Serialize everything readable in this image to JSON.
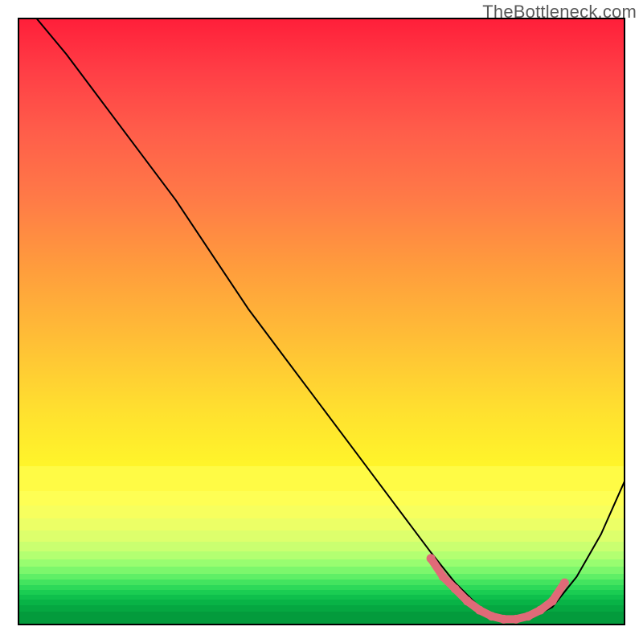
{
  "watermark": "TheBottleneck.com",
  "chart_data": {
    "type": "line",
    "title": "",
    "xlabel": "",
    "ylabel": "",
    "xlim": [
      0,
      100
    ],
    "ylim": [
      0,
      100
    ],
    "grid": false,
    "legend": false,
    "series": [
      {
        "name": "curve",
        "color": "#000000",
        "x": [
          3,
          8,
          14,
          20,
          26,
          32,
          38,
          44,
          50,
          56,
          62,
          68,
          72,
          76,
          80,
          84,
          88,
          92,
          96,
          100
        ],
        "y": [
          100,
          94,
          86,
          78,
          70,
          61,
          52,
          44,
          36,
          28,
          20,
          12,
          7,
          3,
          1,
          1,
          3,
          8,
          15,
          24
        ]
      }
    ],
    "highlight": {
      "name": "optimal-range",
      "color": "#e06a78",
      "x": [
        68,
        70,
        72,
        74,
        76,
        78,
        80,
        82,
        84,
        86,
        88,
        90
      ],
      "y": [
        11,
        8,
        6,
        4,
        2.5,
        1.5,
        1,
        1,
        1.5,
        2.5,
        4,
        7
      ]
    },
    "background_gradient_bands": [
      {
        "height_pct": 4.0,
        "color": "#fffb45"
      },
      {
        "height_pct": 2.4,
        "color": "#feff54"
      },
      {
        "height_pct": 2.2,
        "color": "#f7ff5e"
      },
      {
        "height_pct": 2.0,
        "color": "#ecff66"
      },
      {
        "height_pct": 1.8,
        "color": "#ddff6c"
      },
      {
        "height_pct": 1.6,
        "color": "#caff70"
      },
      {
        "height_pct": 1.4,
        "color": "#b3ff71"
      },
      {
        "height_pct": 1.2,
        "color": "#98fd70"
      },
      {
        "height_pct": 1.1,
        "color": "#7cf76c"
      },
      {
        "height_pct": 1.0,
        "color": "#5fef66"
      },
      {
        "height_pct": 0.9,
        "color": "#43e45f"
      },
      {
        "height_pct": 0.8,
        "color": "#2dd959"
      },
      {
        "height_pct": 0.8,
        "color": "#1acd52"
      },
      {
        "height_pct": 0.8,
        "color": "#0fc04c"
      },
      {
        "height_pct": 1.0,
        "color": "#08b346"
      },
      {
        "height_pct": 1.0,
        "color": "#05a741"
      },
      {
        "height_pct": 2.0,
        "color": "#039b3c"
      }
    ]
  }
}
